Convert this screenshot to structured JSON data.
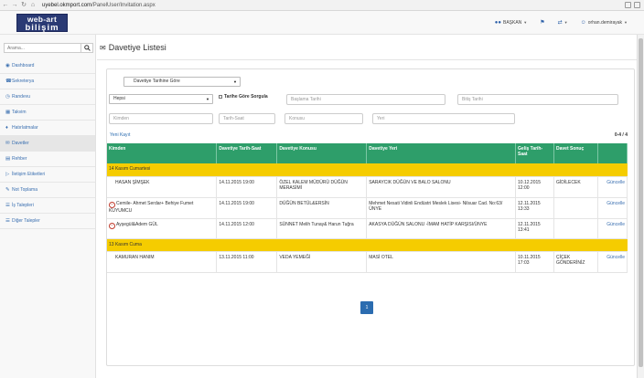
{
  "browser": {
    "url_host": "uyebel.okmport.com",
    "url_path": "/PanelUser/Invitation.aspx"
  },
  "navbar": {
    "logo_line1": "web-art",
    "logo_line2": "bilişim",
    "items": [
      {
        "icon": "users-icon",
        "label": "BAŞKAN"
      },
      {
        "icon": "flag-icon",
        "label": ""
      },
      {
        "icon": "shuffle-icon",
        "label": ""
      },
      {
        "icon": "user-icon",
        "label": "orhan.demirayak"
      }
    ]
  },
  "sidebar": {
    "search_placeholder": "Arama...",
    "items": [
      {
        "icon": "dashboard-icon",
        "label": "Dashboard"
      },
      {
        "icon": "phone-icon",
        "label": "Sekreterya"
      },
      {
        "icon": "clock-icon",
        "label": "Randevu"
      },
      {
        "icon": "calendar-icon",
        "label": "Takvim"
      },
      {
        "icon": "bell-icon",
        "label": "Hatırlatmalar"
      },
      {
        "icon": "envelope-icon",
        "label": "Davetler"
      },
      {
        "icon": "book-icon",
        "label": "Rehber"
      },
      {
        "icon": "tag-icon",
        "label": "İletişim Etiketleri"
      },
      {
        "icon": "pencil-icon",
        "label": "Not Toplama"
      },
      {
        "icon": "list-icon",
        "label": "İş Talepleri"
      },
      {
        "icon": "list-icon",
        "label": "Diğer Talepler"
      }
    ]
  },
  "page": {
    "title": "Davetiye Listesi"
  },
  "filters": {
    "sort_select": "Davetiye Tarihine Göre",
    "status_select": "Hepsi",
    "date_query_label": "Tarihe Göre Sorgula",
    "start_date_placeholder": "Başlama Tarihi",
    "end_date_placeholder": "Bitiş Tarihi",
    "from_placeholder": "Kimden",
    "datetime_placeholder": "Tarih-Saat",
    "subject_placeholder": "Konusu",
    "place_placeholder": "Yeri"
  },
  "list": {
    "new_record": "Yeni Kayıt",
    "count": "0-4 / 4",
    "columns": [
      "Kimden",
      "Davetiye Tarih-Saat",
      "Davetiye Konusu",
      "Davetiye Yeri",
      "Geliş Tarih-Saat",
      "Davet Sonuç",
      ""
    ],
    "groups": [
      {
        "title": "14 Kasım Cumartesi",
        "rows": [
          {
            "deletable": false,
            "from": "HASAN ŞİMŞEK",
            "datetime": "14.11.2015 19:00",
            "subject": "ÖZEL KALEM MÜDÜRÜ DÜĞÜN MERASİMİ",
            "place": "SARAYCIK DÜĞÜN VE BALO SALONU",
            "arrival": "10.12.2015 12:00",
            "result": "GİDİLECEK",
            "action": "Güncelle"
          },
          {
            "deletable": true,
            "from": "Cemile- Ahmet Serdar+ Behiye Fumet KUYUMCU",
            "datetime": "14.11.2015 19:00",
            "subject": "DÜĞÜN BETÜL&ERSİN",
            "place": "Mehmet Nesati Vidinli Endüstri Meslek Lisesi- Nilsuar Cad. No:63/ ÜNYE",
            "arrival": "12.11.2015 13:33",
            "result": "",
            "action": "Güncelle"
          },
          {
            "deletable": true,
            "from": "Ayşegül&Adem GÜL",
            "datetime": "14.11.2015 12:00",
            "subject": "SÜNNET Melih Tunay& Harun Tuğra",
            "place": "AKASYA DÜĞÜN SALONU -İMAM HATİP KARŞISI/ÜNYE",
            "arrival": "12.11.2015 13:41",
            "result": "",
            "action": "Güncelle"
          }
        ]
      },
      {
        "title": "13 Kasım Cuma",
        "rows": [
          {
            "deletable": false,
            "from": "KAMURAN HANIM",
            "datetime": "13.11.2015 11:00",
            "subject": "VEDA YEMEĞİ",
            "place": "MASİ OTEL",
            "arrival": "10.11.2015 17:03",
            "result": "ÇİÇEK GÖNDERİNİZ",
            "action": "Güncelle"
          }
        ]
      }
    ],
    "pages": [
      "1"
    ]
  }
}
